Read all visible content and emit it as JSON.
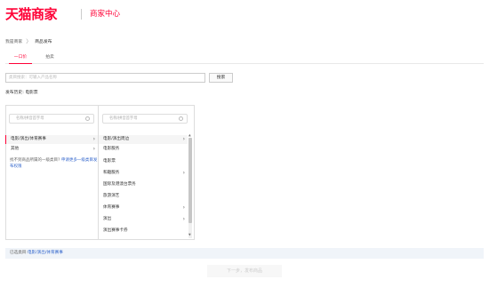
{
  "header": {
    "logo": "天猫商家",
    "center_title": "商家中心"
  },
  "breadcrumb": {
    "home": "我是商家",
    "separator": "〉",
    "current": "商品发布"
  },
  "tabs": [
    {
      "label": "一口价",
      "active": true
    },
    {
      "label": "拍卖",
      "active": false
    }
  ],
  "search": {
    "placeholder": "类目搜索：可输入产品名称",
    "button": "搜索"
  },
  "history": "发布历史: 电影票",
  "category": {
    "filter_placeholder_1": "名称/拼音首字母",
    "filter_placeholder_2": "名称/拼音首字母",
    "level1": [
      {
        "label": "电影/演出/体育赛事",
        "has_children": true,
        "selected": true
      },
      {
        "label": "其他",
        "has_children": true,
        "selected": false
      }
    ],
    "note_text": "找不到商品所属的一级类目?",
    "note_link": "申请更多一级类目发布权限",
    "level2": [
      {
        "label": "电影/演出周边",
        "has_children": true
      },
      {
        "label": "电影服务",
        "has_children": false
      },
      {
        "label": "电影票",
        "has_children": false
      },
      {
        "label": "和趣服务",
        "has_children": true
      },
      {
        "label": "国际及港澳台票务",
        "has_children": false
      },
      {
        "label": "旅游演艺",
        "has_children": false
      },
      {
        "label": "体育赛事",
        "has_children": true
      },
      {
        "label": "演出",
        "has_children": true
      },
      {
        "label": "演出赛事卡券",
        "has_children": false
      }
    ]
  },
  "selected": {
    "label": "已选类目:",
    "value": "电影/演出/体育赛事"
  },
  "next_button": "下一步，发布商品",
  "colors": {
    "brand": "#ff0036",
    "link": "#3366cc"
  }
}
